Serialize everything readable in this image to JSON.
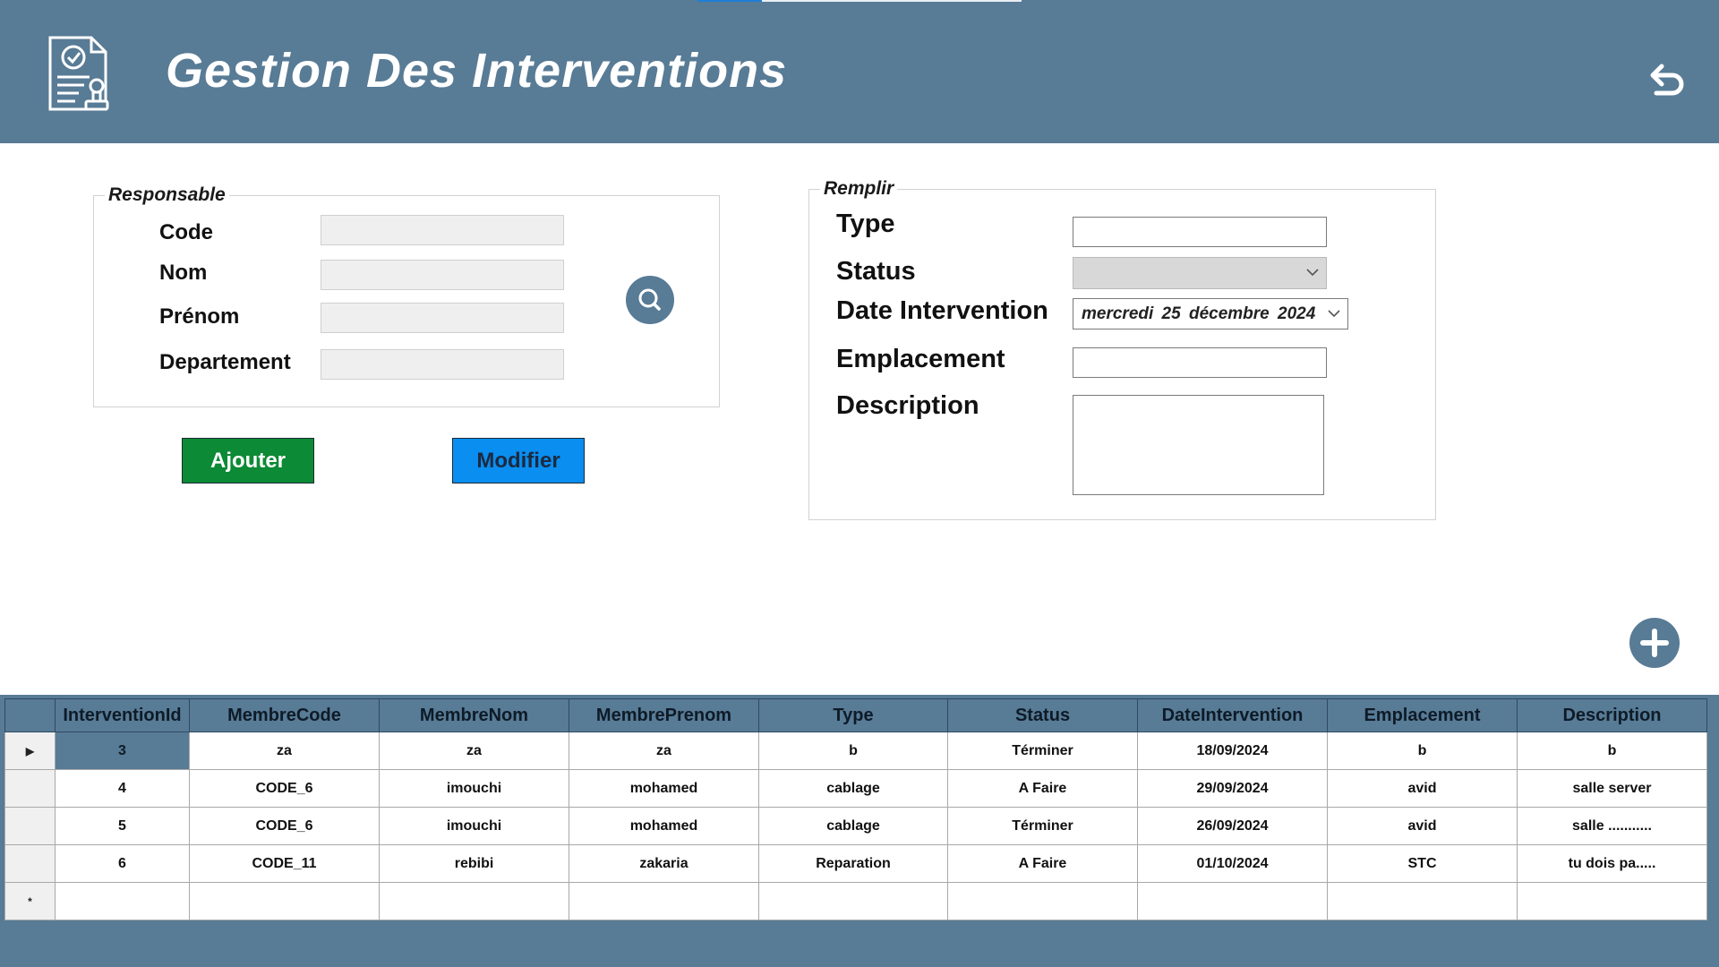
{
  "header": {
    "title": "Gestion Des Interventions",
    "icon": "document-stamp-icon",
    "back_icon": "undo-arrow-icon",
    "background_color": "#587b96"
  },
  "responsable": {
    "legend": "Responsable",
    "fields": [
      {
        "label": "Code",
        "value": ""
      },
      {
        "label": "Nom",
        "value": ""
      },
      {
        "label": "Prénom",
        "value": ""
      },
      {
        "label": "Departement",
        "value": ""
      }
    ],
    "search_icon": "search-icon"
  },
  "actions": {
    "ajouter": "Ajouter",
    "modifier": "Modifier",
    "ajouter_color": "#0c8a35",
    "modifier_color": "#0a8ef0"
  },
  "remplir": {
    "legend": "Remplir",
    "type_label": "Type",
    "type_value": "",
    "status_label": "Status",
    "status_value": "",
    "date_label": "Date Intervention",
    "date_value": "mercredi  25  décembre  2024",
    "emplacement_label": "Emplacement",
    "emplacement_value": "",
    "description_label": "Description",
    "description_value": ""
  },
  "add_icon": "plus-circle-icon",
  "grid": {
    "columns": [
      "InterventionId",
      "MembreCode",
      "MembreNom",
      "MembrePrenom",
      "Type",
      "Status",
      "DateIntervention",
      "Emplacement",
      "Description"
    ],
    "rows": [
      [
        "3",
        "za",
        "za",
        "za",
        "b",
        "Términer",
        "18/09/2024",
        "b",
        "b"
      ],
      [
        "4",
        "CODE_6",
        "imouchi",
        "mohamed",
        "cablage",
        "A Faire",
        "29/09/2024",
        "avid",
        "salle server"
      ],
      [
        "5",
        "CODE_6",
        "imouchi",
        "mohamed",
        "cablage",
        "Términer",
        "26/09/2024",
        "avid",
        "salle ..........."
      ],
      [
        "6",
        "CODE_11",
        "rebibi",
        "zakaria",
        "Reparation",
        "A Faire",
        "01/10/2024",
        "STC",
        "tu dois pa....."
      ]
    ],
    "current_row_marker": "▶",
    "new_row_marker": "*"
  }
}
